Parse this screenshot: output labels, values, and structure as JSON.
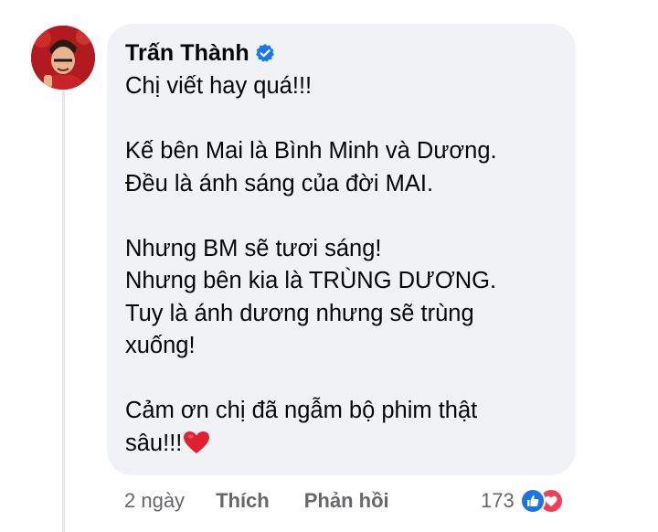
{
  "comment": {
    "author": "Trấn Thành",
    "lines": [
      "Chị viết hay quá!!!",
      "",
      "Kế bên Mai là Bình Minh và Dương.",
      "Đều là ánh sáng của đời MAI.",
      "",
      "Nhưng BM sẽ tươi sáng!",
      "Nhưng bên kia là TRÙNG DƯƠNG.",
      "Tuy là ánh dương nhưng sẽ trùng",
      "xuống!",
      "",
      "Cảm ơn chị đã ngẫm bộ phim thật",
      "sâu!!!"
    ],
    "trailing_emoji": "red-heart-emoji"
  },
  "actions": {
    "time": "2 ngày",
    "like_label": "Thích",
    "reply_label": "Phản hồi"
  },
  "reactions": {
    "count": "173",
    "types": [
      "like",
      "love"
    ]
  },
  "colors": {
    "bubble_bg": "#f0f2f5",
    "text": "#050505",
    "secondary_text": "#65676b",
    "verified_blue": "#1877f2",
    "like_blue": "#1b74e4",
    "love_red": "#f33e58",
    "heart_red": "#e0202e"
  },
  "icons": {
    "verified": "verified-badge-icon",
    "like": "like-reaction-icon",
    "love": "love-reaction-icon"
  }
}
